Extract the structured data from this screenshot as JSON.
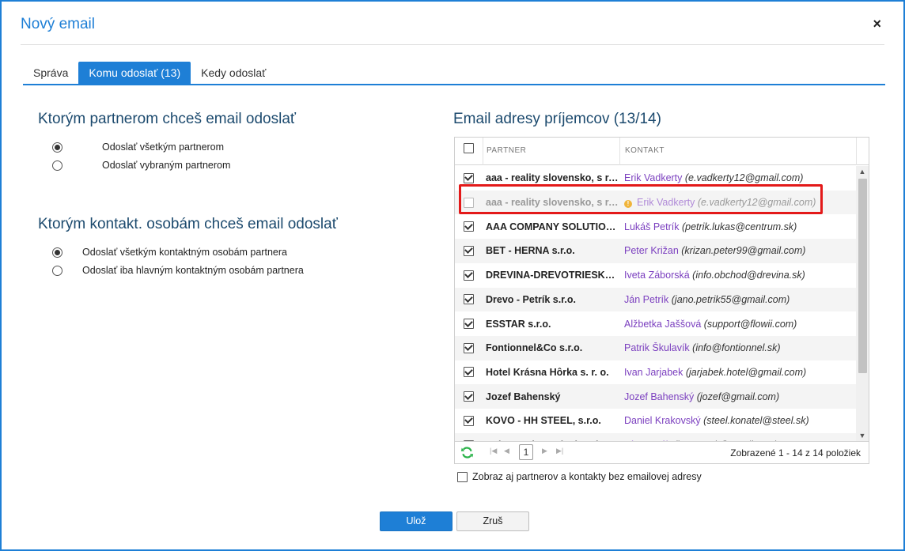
{
  "dialog": {
    "title": "Nový email",
    "close_label": "×"
  },
  "tabs": [
    {
      "label": "Správa",
      "active": false
    },
    {
      "label": "Komu odoslať (13)",
      "active": true
    },
    {
      "label": "Kedy odoslať",
      "active": false
    }
  ],
  "partners_section": {
    "title": "Ktorým partnerom chceš email odoslať",
    "options": [
      {
        "label": "Odoslať všetkým partnerom",
        "checked": true
      },
      {
        "label": "Odoslať vybraným partnerom",
        "checked": false
      }
    ]
  },
  "contacts_section": {
    "title": "Ktorým kontakt. osobám chceš email odoslať",
    "options": [
      {
        "label": "Odoslať všetkým kontaktným osobám partnera",
        "checked": true
      },
      {
        "label": "Odoslať iba hlavným kontaktným osobám partnera",
        "checked": false
      }
    ]
  },
  "recipients": {
    "title": "Email adresy príjemcov (13/14)",
    "columns": {
      "partner": "PARTNER",
      "contact": "KONTAKT"
    },
    "rows": [
      {
        "checked": true,
        "partner": "aaa - reality slovensko, s r.o.",
        "contact_name": "Erik Vadkerty",
        "contact_email": "(e.vadkerty12@gmail.com)",
        "disabled": false
      },
      {
        "checked": false,
        "partner": "aaa - reality slovensko, s r.o.",
        "contact_name": "Erik Vadkerty",
        "contact_email": "(e.vadkerty12@gmail.com)",
        "disabled": true
      },
      {
        "checked": true,
        "partner": "AAA COMPANY SOLUTIONS",
        "contact_name": "Lukáš Petrík",
        "contact_email": "(petrik.lukas@centrum.sk)",
        "disabled": false
      },
      {
        "checked": true,
        "partner": "BET - HERNA s.r.o.",
        "contact_name": "Peter Križan",
        "contact_email": "(krizan.peter99@gmail.com)",
        "disabled": false
      },
      {
        "checked": true,
        "partner": "DREVINA-DREVOTRIESKA,...",
        "contact_name": "Iveta Záborská",
        "contact_email": "(info.obchod@drevina.sk)",
        "disabled": false
      },
      {
        "checked": true,
        "partner": "Drevo - Petrík s.r.o.",
        "contact_name": "Ján Petrík",
        "contact_email": "(jano.petrik55@gmail.com)",
        "disabled": false
      },
      {
        "checked": true,
        "partner": "ESSTAR s.r.o.",
        "contact_name": "Alžbetka Jaššová",
        "contact_email": "(support@flowii.com)",
        "disabled": false
      },
      {
        "checked": true,
        "partner": "Fontionnel&Co s.r.o.",
        "contact_name": "Patrik Škulavík",
        "contact_email": "(info@fontionnel.sk)",
        "disabled": false
      },
      {
        "checked": true,
        "partner": "Hotel Krásna Hôrka s. r. o.",
        "contact_name": "Ivan Jarjabek",
        "contact_email": "(jarjabek.hotel@gmail.com)",
        "disabled": false
      },
      {
        "checked": true,
        "partner": "Jozef Bahenský",
        "contact_name": "Jozef Bahenský",
        "contact_email": "(jozef@gmail.com)",
        "disabled": false
      },
      {
        "checked": true,
        "partner": "KOVO - HH STEEL, s.r.o.",
        "contact_name": "Daniel Krakovský",
        "contact_email": "(steel.konatel@steel.sk)",
        "disabled": false
      },
      {
        "checked": true,
        "partner": "Balov - zakrcený a hotel",
        "contact_name": "Ján Novák",
        "contact_email": "(jan.novak@gmail.com)",
        "disabled": false
      }
    ],
    "pager": {
      "page": "1",
      "info": "Zobrazené 1 - 14 z 14 položiek"
    }
  },
  "show_all_label": "Zobraz aj partnerov a kontakty bez emailovej adresy",
  "buttons": {
    "save": "Ulož",
    "cancel": "Zruš"
  },
  "colors": {
    "accent": "#1e7fd6",
    "contact_link": "#7b3fbf",
    "highlight": "#e31919"
  }
}
